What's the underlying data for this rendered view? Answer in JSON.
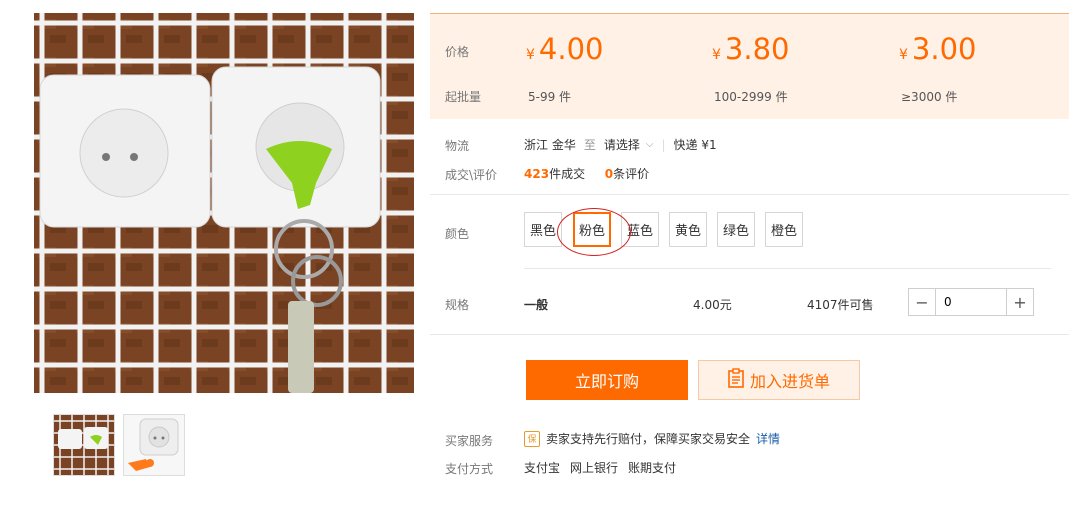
{
  "price_box": {
    "price_label": "价格",
    "moq_label": "起批量",
    "tiers": [
      {
        "yen": "¥",
        "price": "4.00",
        "range": "5-99 件"
      },
      {
        "yen": "¥",
        "price": "3.80",
        "range": "100-2999 件"
      },
      {
        "yen": "¥",
        "price": "3.00",
        "range": "≥3000 件"
      }
    ]
  },
  "logistics": {
    "label": "物流",
    "origin": "浙江 金华",
    "to": "至",
    "destination": "请选择",
    "express": "快递 ¥1"
  },
  "deals": {
    "label": "成交\\评价",
    "count": "423",
    "count_suffix": "件成交",
    "reviews": "0",
    "reviews_suffix": "条评价"
  },
  "colors": {
    "label": "颜色",
    "options": [
      "黑色",
      "粉色",
      "蓝色",
      "黄色",
      "绿色",
      "橙色"
    ],
    "selected_index": 1
  },
  "spec": {
    "label": "规格",
    "name": "一般",
    "price": "4.00元",
    "stock": "4107件可售",
    "quantity": "0",
    "minus": "−",
    "plus": "+"
  },
  "actions": {
    "order_label": "立即订购",
    "cart_label": "加入进货单"
  },
  "services": {
    "label": "买家服务",
    "badge": "保",
    "text": "卖家支持先行赔付，保障买家交易安全",
    "link": "详情"
  },
  "payment": {
    "label": "支付方式",
    "methods": [
      "支付宝",
      "网上银行",
      "账期支付"
    ]
  },
  "theme": {
    "accent": "#ff6a00",
    "price_bg": "#fff1e6",
    "link": "#1a5ea8"
  }
}
